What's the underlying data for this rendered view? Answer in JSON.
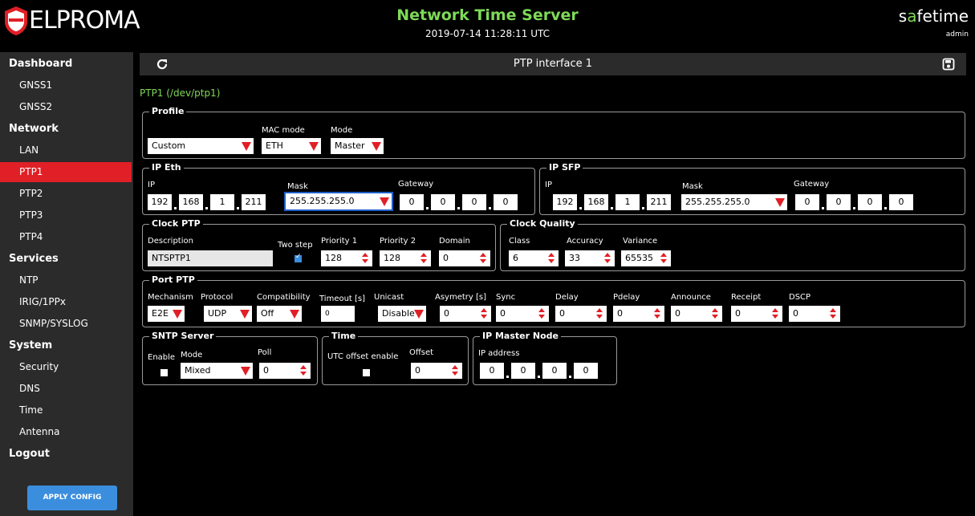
{
  "header": {
    "logo_text": "ELPROMA",
    "title": "Network Time Server",
    "datetime": "2019-07-14 11:28:11 UTC",
    "brand_prefix": "s",
    "brand_accent": "a",
    "brand_suffix": "fetime",
    "user": "admin"
  },
  "sidebar": {
    "items": [
      {
        "label": "Dashboard"
      },
      {
        "label": "GNSS1"
      },
      {
        "label": "GNSS2"
      },
      {
        "label": "Network"
      },
      {
        "label": "LAN"
      },
      {
        "label": "PTP1"
      },
      {
        "label": "PTP2"
      },
      {
        "label": "PTP3"
      },
      {
        "label": "PTP4"
      },
      {
        "label": "Services"
      },
      {
        "label": "NTP"
      },
      {
        "label": "IRIG/1PPx"
      },
      {
        "label": "SNMP/SYSLOG"
      },
      {
        "label": "System"
      },
      {
        "label": "Security"
      },
      {
        "label": "DNS"
      },
      {
        "label": "Time"
      },
      {
        "label": "Antenna"
      },
      {
        "label": "Logout"
      }
    ],
    "apply_label": "APPLY CONFIG"
  },
  "toolbar": {
    "title": "PTP interface 1"
  },
  "iface_path": "PTP1 (/dev/ptp1)",
  "profile": {
    "legend": "Profile",
    "profile_value": "Custom",
    "mac_label": "MAC mode",
    "mac_value": "ETH",
    "mode_label": "Mode",
    "mode_value": "Master"
  },
  "ip_eth": {
    "legend": "IP Eth",
    "ip_label": "IP",
    "ip": [
      "192",
      "168",
      "1",
      "211"
    ],
    "mask_label": "Mask",
    "mask": "255.255.255.0",
    "gw_label": "Gateway",
    "gw": [
      "0",
      "0",
      "0",
      "0"
    ]
  },
  "ip_sfp": {
    "legend": "IP SFP",
    "ip_label": "IP",
    "ip": [
      "192",
      "168",
      "1",
      "211"
    ],
    "mask_label": "Mask",
    "mask": "255.255.255.0",
    "gw_label": "Gateway",
    "gw": [
      "0",
      "0",
      "0",
      "0"
    ]
  },
  "clock_ptp": {
    "legend": "Clock PTP",
    "desc_label": "Description",
    "desc": "NTSPTP1",
    "twostep_label": "Two step",
    "p1_label": "Priority 1",
    "p1": "128",
    "p2_label": "Priority 2",
    "p2": "128",
    "domain_label": "Domain",
    "domain": "0"
  },
  "clock_quality": {
    "legend": "Clock Quality",
    "class_label": "Class",
    "class": "6",
    "accuracy_label": "Accuracy",
    "accuracy": "33",
    "variance_label": "Variance",
    "variance": "65535"
  },
  "port_ptp": {
    "legend": "Port PTP",
    "mechanism_label": "Mechanism",
    "mechanism": "E2E",
    "protocol_label": "Protocol",
    "protocol": "UDP",
    "compat_label": "Compatibility",
    "compat": "Off",
    "timeout_label": "Timeout [s]",
    "timeout": "0",
    "unicast_label": "Unicast",
    "unicast": "Disable",
    "asym_label": "Asymetry [s]",
    "asym": "0",
    "sync_label": "Sync",
    "sync": "0",
    "delay_label": "Delay",
    "delay": "0",
    "pdelay_label": "Pdelay",
    "pdelay": "0",
    "announce_label": "Announce",
    "announce": "0",
    "receipt_label": "Receipt",
    "receipt": "0",
    "dscp_label": "DSCP",
    "dscp": "0"
  },
  "sntp": {
    "legend": "SNTP Server",
    "enable_label": "Enable",
    "mode_label": "Mode",
    "mode": "Mixed",
    "poll_label": "Poll",
    "poll": "0"
  },
  "time": {
    "legend": "Time",
    "utc_label": "UTC offset enable",
    "offset_label": "Offset",
    "offset": "0"
  },
  "master": {
    "legend": "IP Master Node",
    "ip_label": "IP address",
    "ip": [
      "0",
      "0",
      "0",
      "0"
    ]
  },
  "colors": {
    "accent_green": "#7ed957",
    "active_red": "#e01f26",
    "button_blue": "#3b8ede",
    "sidebar_bg": "#2b2b2b"
  }
}
